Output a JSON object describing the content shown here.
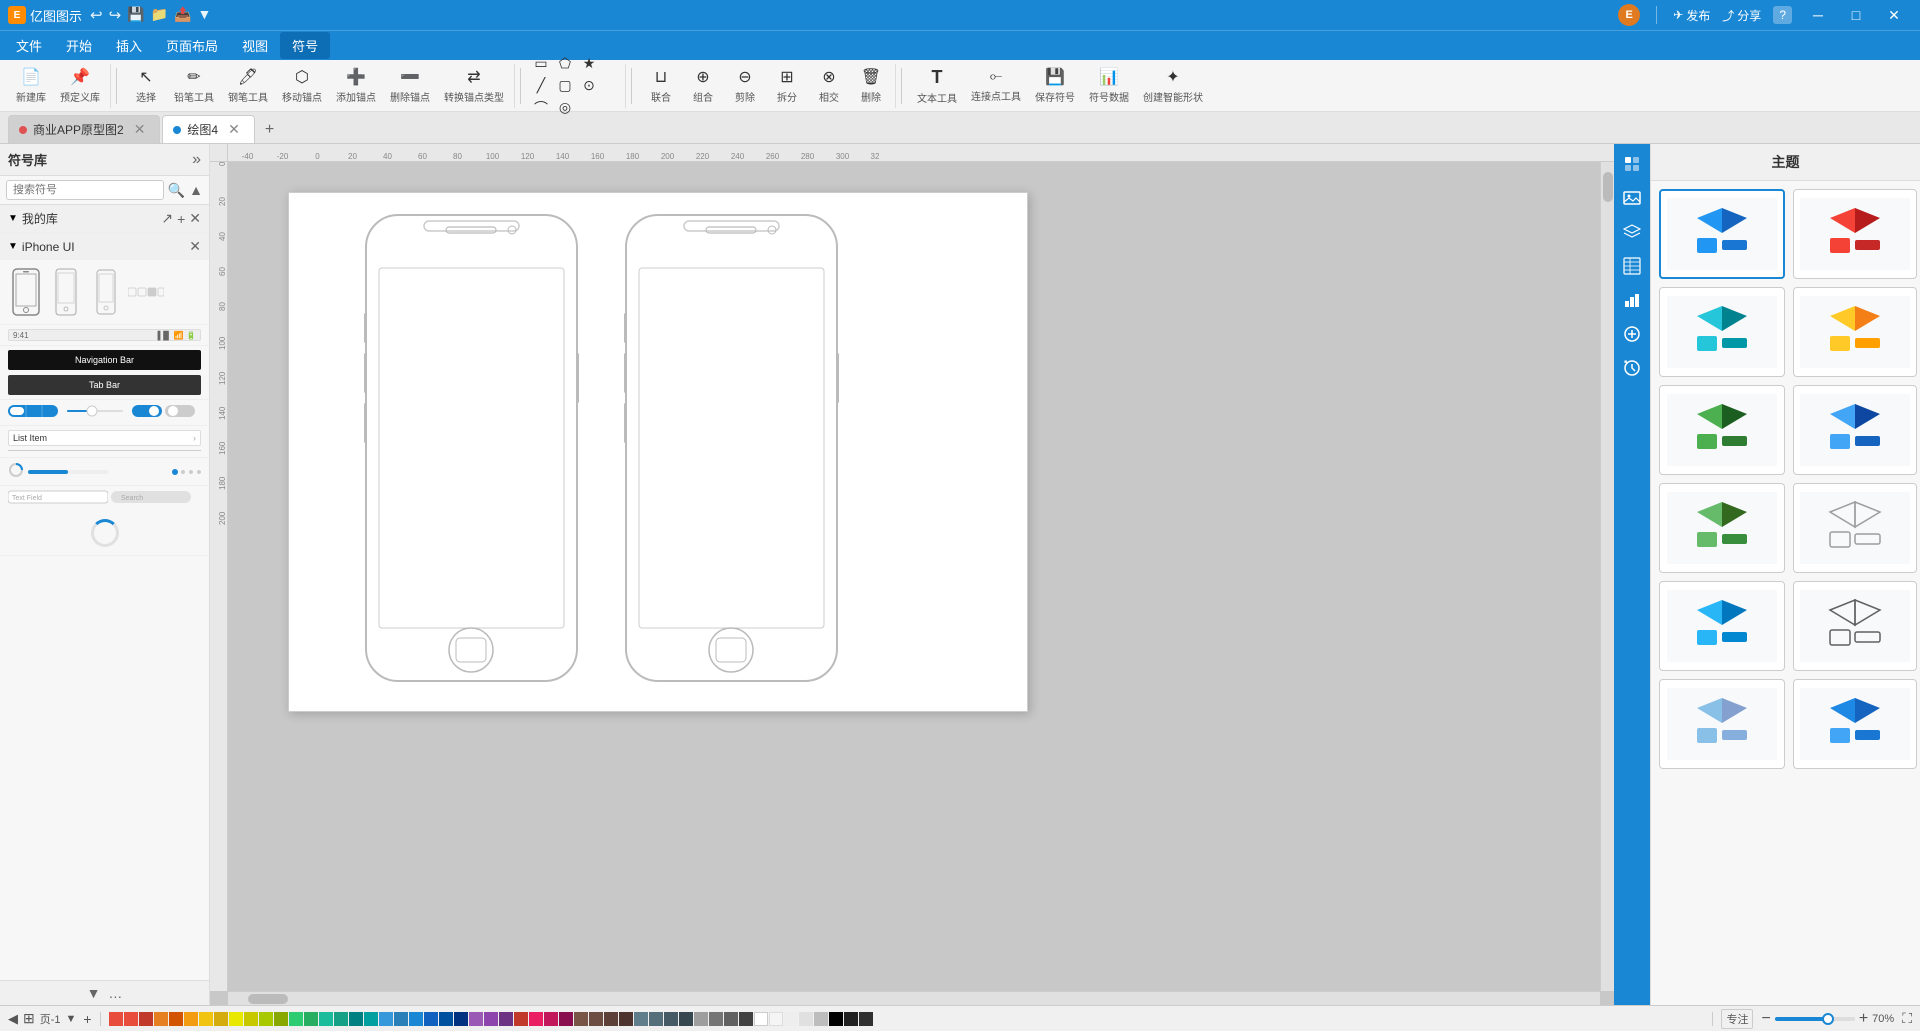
{
  "app": {
    "title": "亿图图示",
    "logo_char": "E"
  },
  "titlebar": {
    "undo": "↩",
    "redo": "↪",
    "save": "💾",
    "user_avatar": "E",
    "publish_label": "发布",
    "share_label": "分享",
    "help_label": "?"
  },
  "menubar": {
    "items": [
      "文件",
      "开始",
      "插入",
      "页面布局",
      "视图",
      "符号"
    ]
  },
  "toolbar": {
    "groups": [
      {
        "name": "new",
        "items": [
          {
            "icon": "📄",
            "label": "新建库"
          },
          {
            "icon": "📌",
            "label": "预定义库"
          }
        ]
      }
    ],
    "tools": [
      {
        "icon": "↖",
        "label": "选择"
      },
      {
        "icon": "✏",
        "label": "铅笔工具"
      },
      {
        "icon": "🖊",
        "label": "钢笔工具"
      },
      {
        "icon": "⬡",
        "label": "移动锚点"
      },
      {
        "icon": "+",
        "label": "添加锚点"
      },
      {
        "icon": "−",
        "label": "删除锚点"
      },
      {
        "icon": "⇌",
        "label": "转换锚点类型"
      }
    ],
    "shapes": [
      {
        "icon": "▭",
        "label": ""
      },
      {
        "icon": "⬠",
        "label": ""
      },
      {
        "icon": "★",
        "label": ""
      },
      {
        "icon": "╱",
        "label": ""
      },
      {
        "icon": "▢",
        "label": ""
      },
      {
        "icon": "⊙",
        "label": ""
      },
      {
        "icon": "⌒",
        "label": ""
      },
      {
        "icon": "◎",
        "label": ""
      }
    ],
    "actions": [
      {
        "label": "联合"
      },
      {
        "label": "组合"
      },
      {
        "label": "剪除"
      },
      {
        "label": "拆分"
      },
      {
        "label": "相交"
      },
      {
        "label": "删除"
      }
    ],
    "text_tools": [
      {
        "icon": "T",
        "label": "文本工具"
      },
      {
        "label": "连接点工具"
      },
      {
        "label": "保存符号"
      },
      {
        "label": "符号数据"
      },
      {
        "label": "创建智能形状"
      }
    ]
  },
  "tabs": {
    "docs": [
      {
        "label": "商业APP原型图2",
        "active": false,
        "dot_color": "#e05252"
      },
      {
        "label": "绘图4",
        "active": true,
        "dot_color": "#1a87d4"
      }
    ]
  },
  "sidebar": {
    "title": "符号库",
    "search_placeholder": "搜索符号",
    "sections": [
      {
        "name": "我的库",
        "expanded": true,
        "items": []
      },
      {
        "name": "iPhone UI",
        "expanded": true,
        "items": [
          "iphone-front",
          "iphone-outline",
          "iphone-flat",
          "iphone-dots",
          "status-bar",
          "nav-bar",
          "tab-bar",
          "toolbar-bar",
          "black-btn",
          "blue-btn",
          "segment-control",
          "slider",
          "switch",
          "list-item",
          "table-row"
        ]
      }
    ]
  },
  "canvas": {
    "zoom": "70%",
    "page_label": "页-1",
    "ruler_marks_h": [
      "-40",
      "-20",
      "0",
      "20",
      "40",
      "60",
      "80",
      "100",
      "120",
      "140",
      "160",
      "180",
      "200",
      "220",
      "240",
      "260",
      "280",
      "300",
      "32"
    ],
    "ruler_marks_v": [
      "0",
      "20",
      "40",
      "60",
      "80",
      "100",
      "120",
      "140",
      "160",
      "180",
      "200"
    ]
  },
  "right_panel": {
    "title": "主题",
    "icons": [
      "grid-icon",
      "image-icon",
      "layers-icon",
      "table-icon",
      "chart-icon",
      "expand-icon",
      "history-icon"
    ],
    "themes": [
      {
        "id": 1,
        "selected": true
      },
      {
        "id": 2,
        "selected": false
      },
      {
        "id": 3,
        "selected": false
      },
      {
        "id": 4,
        "selected": false
      },
      {
        "id": 5,
        "selected": false
      },
      {
        "id": 6,
        "selected": false
      },
      {
        "id": 7,
        "selected": false
      },
      {
        "id": 8,
        "selected": false
      },
      {
        "id": 9,
        "selected": false
      },
      {
        "id": 10,
        "selected": false
      },
      {
        "id": 11,
        "selected": false
      },
      {
        "id": 12,
        "selected": false
      }
    ]
  },
  "status_bar": {
    "page_label": "页-1",
    "zoom_label": "70%",
    "fit_label": "专注",
    "colors": [
      "#e74c3c",
      "#e84c3c",
      "#e95c4c",
      "#d44c3c",
      "#c84c3c",
      "#f05c4c",
      "#e86c5c",
      "#d08050",
      "#c87040",
      "#f09050",
      "#e8a060",
      "#d0b070",
      "#c0a060",
      "#f0b070",
      "#e8b050",
      "#d8c060",
      "#c8b050",
      "#a8a040",
      "#90a040",
      "#80a030",
      "#b0b040",
      "#a0b040",
      "#90c040",
      "#80b030",
      "#70a030",
      "#60c040",
      "#50b030",
      "#40a030",
      "#30b040",
      "#20a030",
      "#10c040",
      "#00a030",
      "#20b050",
      "#10c060",
      "#00b050",
      "#20c070",
      "#10b060",
      "#00a050",
      "#20c080",
      "#10b070",
      "#00a060",
      "#20c090",
      "#10b080",
      "#009080",
      "#208090",
      "#107080",
      "#006070",
      "#205080",
      "#104070",
      "#003060",
      "#204080",
      "#103070",
      "#002060",
      "#205090",
      "#1040a0",
      "#0030b0",
      "#2050c0",
      "#1040d0",
      "#0030e0",
      "#2060c0",
      "#1050d0",
      "#0040e0",
      "#2070c0",
      "#6060d0",
      "#5050c0",
      "#8060c0",
      "#7050b0",
      "#9060a0",
      "#a06090",
      "#906080",
      "#8060a0",
      "#a070b0",
      "#9060a0",
      "#b07090",
      "#c08080",
      "#b07070",
      "#a06060",
      "#d08080",
      "#c07070",
      "#b06060",
      "#e09090",
      "#d08080",
      "#c07070",
      "#808080",
      "#909090",
      "#a0a0a0",
      "#b0b0b0",
      "#c0c0c0",
      "#d0d0d0",
      "#e0e0e0",
      "#f0f0f0",
      "#ffffff",
      "#000000",
      "#101010",
      "#202020",
      "#303030",
      "#404040",
      "#505050",
      "#606060",
      "#707070"
    ]
  }
}
